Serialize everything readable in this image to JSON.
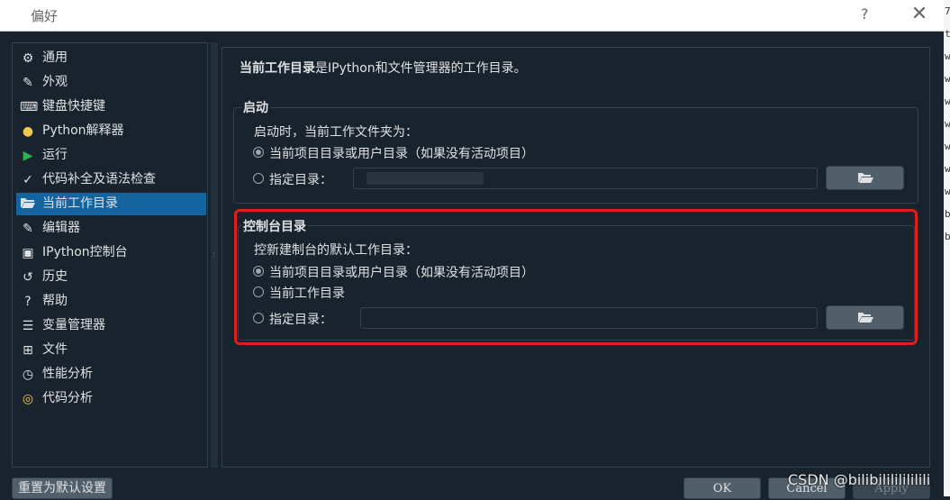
{
  "window": {
    "title": "偏好",
    "help_glyph": "?",
    "close_glyph": "✕"
  },
  "background_text": [
    "7",
    "t",
    "w",
    "w",
    "w",
    "w",
    "w",
    "w",
    "w",
    "b",
    "b"
  ],
  "sidebar": {
    "items": [
      {
        "label": "通用",
        "icon": "gear-icon",
        "glyph": "⚙"
      },
      {
        "label": "外观",
        "icon": "color-picker-icon",
        "glyph": "✎"
      },
      {
        "label": "键盘快捷键",
        "icon": "keyboard-icon",
        "glyph": "⌨"
      },
      {
        "label": "Python解释器",
        "icon": "python-icon",
        "glyph": "●"
      },
      {
        "label": "运行",
        "icon": "play-icon",
        "glyph": "▶"
      },
      {
        "label": "代码补全及语法检查",
        "icon": "code-check-icon",
        "glyph": "✓"
      },
      {
        "label": "当前工作目录",
        "icon": "folder-open-icon",
        "glyph": "📂"
      },
      {
        "label": "编辑器",
        "icon": "edit-icon",
        "glyph": "✎"
      },
      {
        "label": "IPython控制台",
        "icon": "console-icon",
        "glyph": "▣"
      },
      {
        "label": "历史",
        "icon": "history-icon",
        "glyph": "↺"
      },
      {
        "label": "帮助",
        "icon": "help-icon",
        "glyph": "?"
      },
      {
        "label": "变量管理器",
        "icon": "variable-explorer-icon",
        "glyph": "☰"
      },
      {
        "label": "文件",
        "icon": "file-tree-icon",
        "glyph": "⊞"
      },
      {
        "label": "性能分析",
        "icon": "profiler-icon",
        "glyph": "◷"
      },
      {
        "label": "代码分析",
        "icon": "code-analysis-icon",
        "glyph": "◎"
      }
    ],
    "selected_index": 6
  },
  "panel": {
    "intro_bold": "当前工作目录",
    "intro_rest": "是IPython和文件管理器的工作目录。",
    "startup": {
      "title": "启动",
      "prompt": "启动时，当前工作文件夹为：",
      "option_project": "当前项目目录或用户目录（如果没有活动项目）",
      "option_specified": "指定目录：",
      "selected": "project"
    },
    "console": {
      "title": "控制台目录",
      "prompt": "控新建制台的默认工作目录：",
      "option_project": "当前项目目录或用户目录（如果没有活动项目）",
      "option_cwd": "当前工作目录",
      "option_specified": "指定目录：",
      "path_value": "",
      "selected": "project"
    }
  },
  "buttons": {
    "reset": "重置为默认设置",
    "ok": "OK",
    "cancel": "Cancel",
    "apply": "Apply"
  },
  "watermark": "CSDN @bilibilililililili",
  "colors": {
    "background": "#19232d",
    "selection": "#1464a0",
    "highlight_outline": "#e01e1e"
  }
}
